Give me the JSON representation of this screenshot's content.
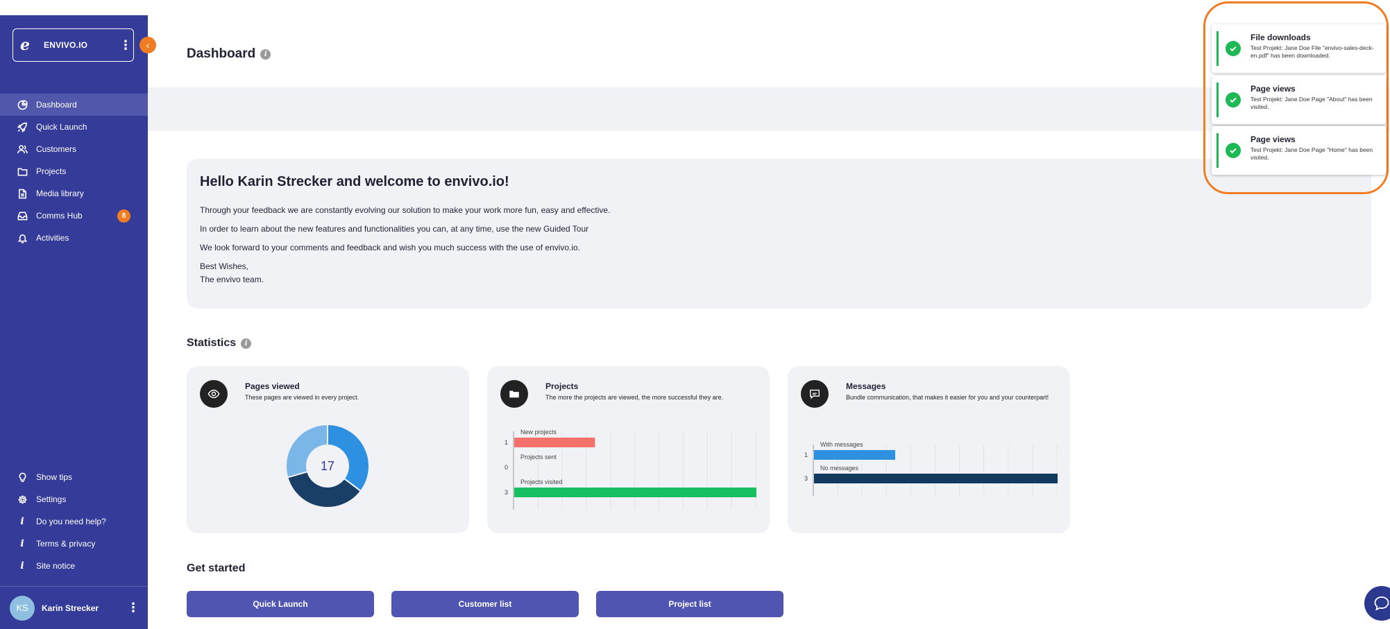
{
  "sidebar": {
    "brand": {
      "logo": "e",
      "name": "ENVIVO.IO"
    },
    "items": [
      {
        "label": "Dashboard",
        "icon": "pie-chart-icon",
        "active": true
      },
      {
        "label": "Quick Launch",
        "icon": "rocket-icon"
      },
      {
        "label": "Customers",
        "icon": "users-icon"
      },
      {
        "label": "Projects",
        "icon": "folder-icon"
      },
      {
        "label": "Media library",
        "icon": "file-icon"
      },
      {
        "label": "Comms Hub",
        "icon": "inbox-icon",
        "badge": "8"
      },
      {
        "label": "Activities",
        "icon": "bell-icon"
      }
    ],
    "bottom_items": [
      {
        "label": "Show tips",
        "icon": "lightbulb-icon"
      },
      {
        "label": "Settings",
        "icon": "gear-icon"
      },
      {
        "label": "Do you need help?",
        "icon": "info-icon"
      },
      {
        "label": "Terms & privacy",
        "icon": "info-icon"
      },
      {
        "label": "Site notice",
        "icon": "info-icon"
      }
    ],
    "user": {
      "initials": "KS",
      "name": "Karin Strecker"
    }
  },
  "header": {
    "title": "Dashboard"
  },
  "welcome": {
    "title": "Hello Karin Strecker and welcome to envivo.io!",
    "line1": "Through your feedback we are constantly evolving our solution to make your work more fun, easy and effective.",
    "line2": "In order to learn about the new features and functionalities you can, at any time, use the new Guided Tour",
    "line3": "We look forward to your comments and feedback and wish you much success with the use of envivo.io.",
    "sign1": "Best Wishes,",
    "sign2": "The envivo team."
  },
  "statistics": {
    "title": "Statistics",
    "cards": [
      {
        "title": "Pages viewed",
        "subtitle": "These pages are viewed in every project.",
        "icon": "eye-icon"
      },
      {
        "title": "Projects",
        "subtitle": "The more the projects are viewed, the more successful they are.",
        "icon": "folder-icon"
      },
      {
        "title": "Messages",
        "subtitle": "Bundle communication, that makes it easier for you and your counterpart!",
        "icon": "chat-icon"
      }
    ]
  },
  "chart_data": [
    {
      "type": "pie",
      "center_label": "17",
      "slices": [
        {
          "value": 6,
          "color": "#2e90e0"
        },
        {
          "value": 6,
          "color": "#1a3f66"
        },
        {
          "value": 5,
          "color": "#7ab7e8"
        }
      ]
    },
    {
      "type": "bar",
      "orientation": "horizontal",
      "categories": [
        "New projects",
        "Projects sent",
        "Projects visited"
      ],
      "values": [
        1,
        0,
        3
      ],
      "colors": [
        "#f4716b",
        "#999999",
        "#16c062"
      ],
      "xlim": [
        0,
        3
      ]
    },
    {
      "type": "bar",
      "orientation": "horizontal",
      "categories": [
        "With messages",
        "No messages"
      ],
      "values": [
        1,
        3
      ],
      "colors": [
        "#2e90e0",
        "#123a5e"
      ],
      "xlim": [
        0,
        3
      ]
    }
  ],
  "get_started": {
    "title": "Get started",
    "buttons": [
      "Quick Launch",
      "Customer list",
      "Project list"
    ]
  },
  "notifications": [
    {
      "title": "File downloads",
      "text": "Test Projekt: Jane Doe File \"envivo-sales-deck-en.pdf\" has been downloaded."
    },
    {
      "title": "Page views",
      "text": "Test Projekt: Jane Doe Page \"About\" has been visited."
    },
    {
      "title": "Page views",
      "text": "Test Projekt: Jane Doe Page \"Home\" has been visited."
    }
  ],
  "colors": {
    "sidebar": "#353b98",
    "accent": "#f07d22",
    "button": "#5055b1",
    "success": "#1db954"
  }
}
